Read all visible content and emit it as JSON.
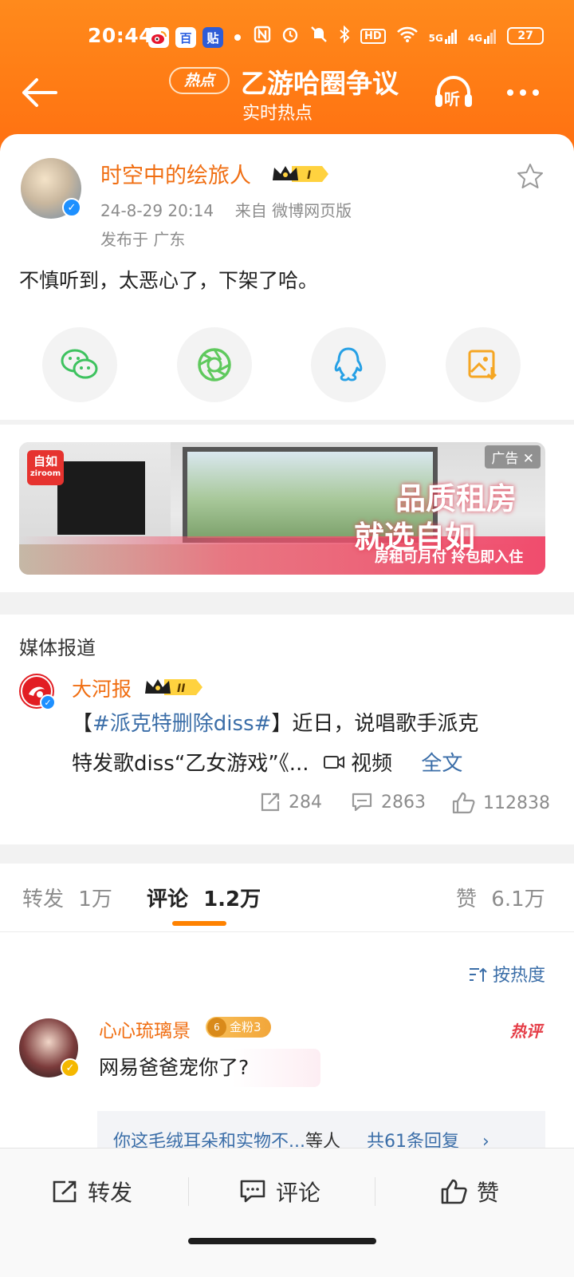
{
  "status_bar": {
    "time": "20:44",
    "app_icon_baidu": "百",
    "app_icon_tieba": "贴",
    "hd_label": "HD",
    "signal1": "5G",
    "signal2": "4G",
    "battery": "27"
  },
  "header": {
    "badge": "热点",
    "title": "乙游哈圈争议",
    "subtitle": "实时热点",
    "listen_label": "听",
    "accent": "#ff7a14"
  },
  "post": {
    "author": "时空中的绘旅人",
    "rank": "I",
    "datetime": "24-8-29  20:14",
    "source_label": "来自  微博网页版",
    "location": "发布于  广东",
    "content": "不慎听到，太恶心了，下架了哈。"
  },
  "share": [
    "wechat-icon",
    "moments-icon",
    "qq-icon",
    "save-image-icon"
  ],
  "ad": {
    "brand_cn": "自如",
    "brand_en": "ziroom",
    "tag": "广告 ✕",
    "headline1": "品质租房",
    "headline2": "就选自如",
    "subline": "房租可月付   拎包即入住"
  },
  "media": {
    "section_title": "媒体报道",
    "outlet": "大河报",
    "rank": "II",
    "bracket_open": "【",
    "hashtag": "#派克特删除diss#",
    "text_after_tag": "】近日，说唱歌手派克",
    "line2": "特发歌diss“乙女游戏”《...",
    "video_label": "视频",
    "fulltext_label": "全文",
    "reposts": "284",
    "comments": "2863",
    "likes": "112838"
  },
  "tabs": {
    "repost_label": "转发",
    "repost_count": "1万",
    "comment_label": "评论",
    "comment_count": "1.2万",
    "like_label": "赞",
    "like_count": "6.1万"
  },
  "comments": {
    "sort_label": "按热度",
    "items": [
      {
        "user": "心心琉璃景",
        "fan_level": "6",
        "fan_badge": "金粉3",
        "hot_tag": "热评",
        "text": "网易爸爸宠你了?",
        "reply_preview": "你这毛绒耳朵和实物不...",
        "reply_suffix": "等人",
        "reply_count": "共61条回复"
      }
    ]
  },
  "bottom_bar": {
    "repost": "转发",
    "comment": "评论",
    "like": "赞"
  }
}
